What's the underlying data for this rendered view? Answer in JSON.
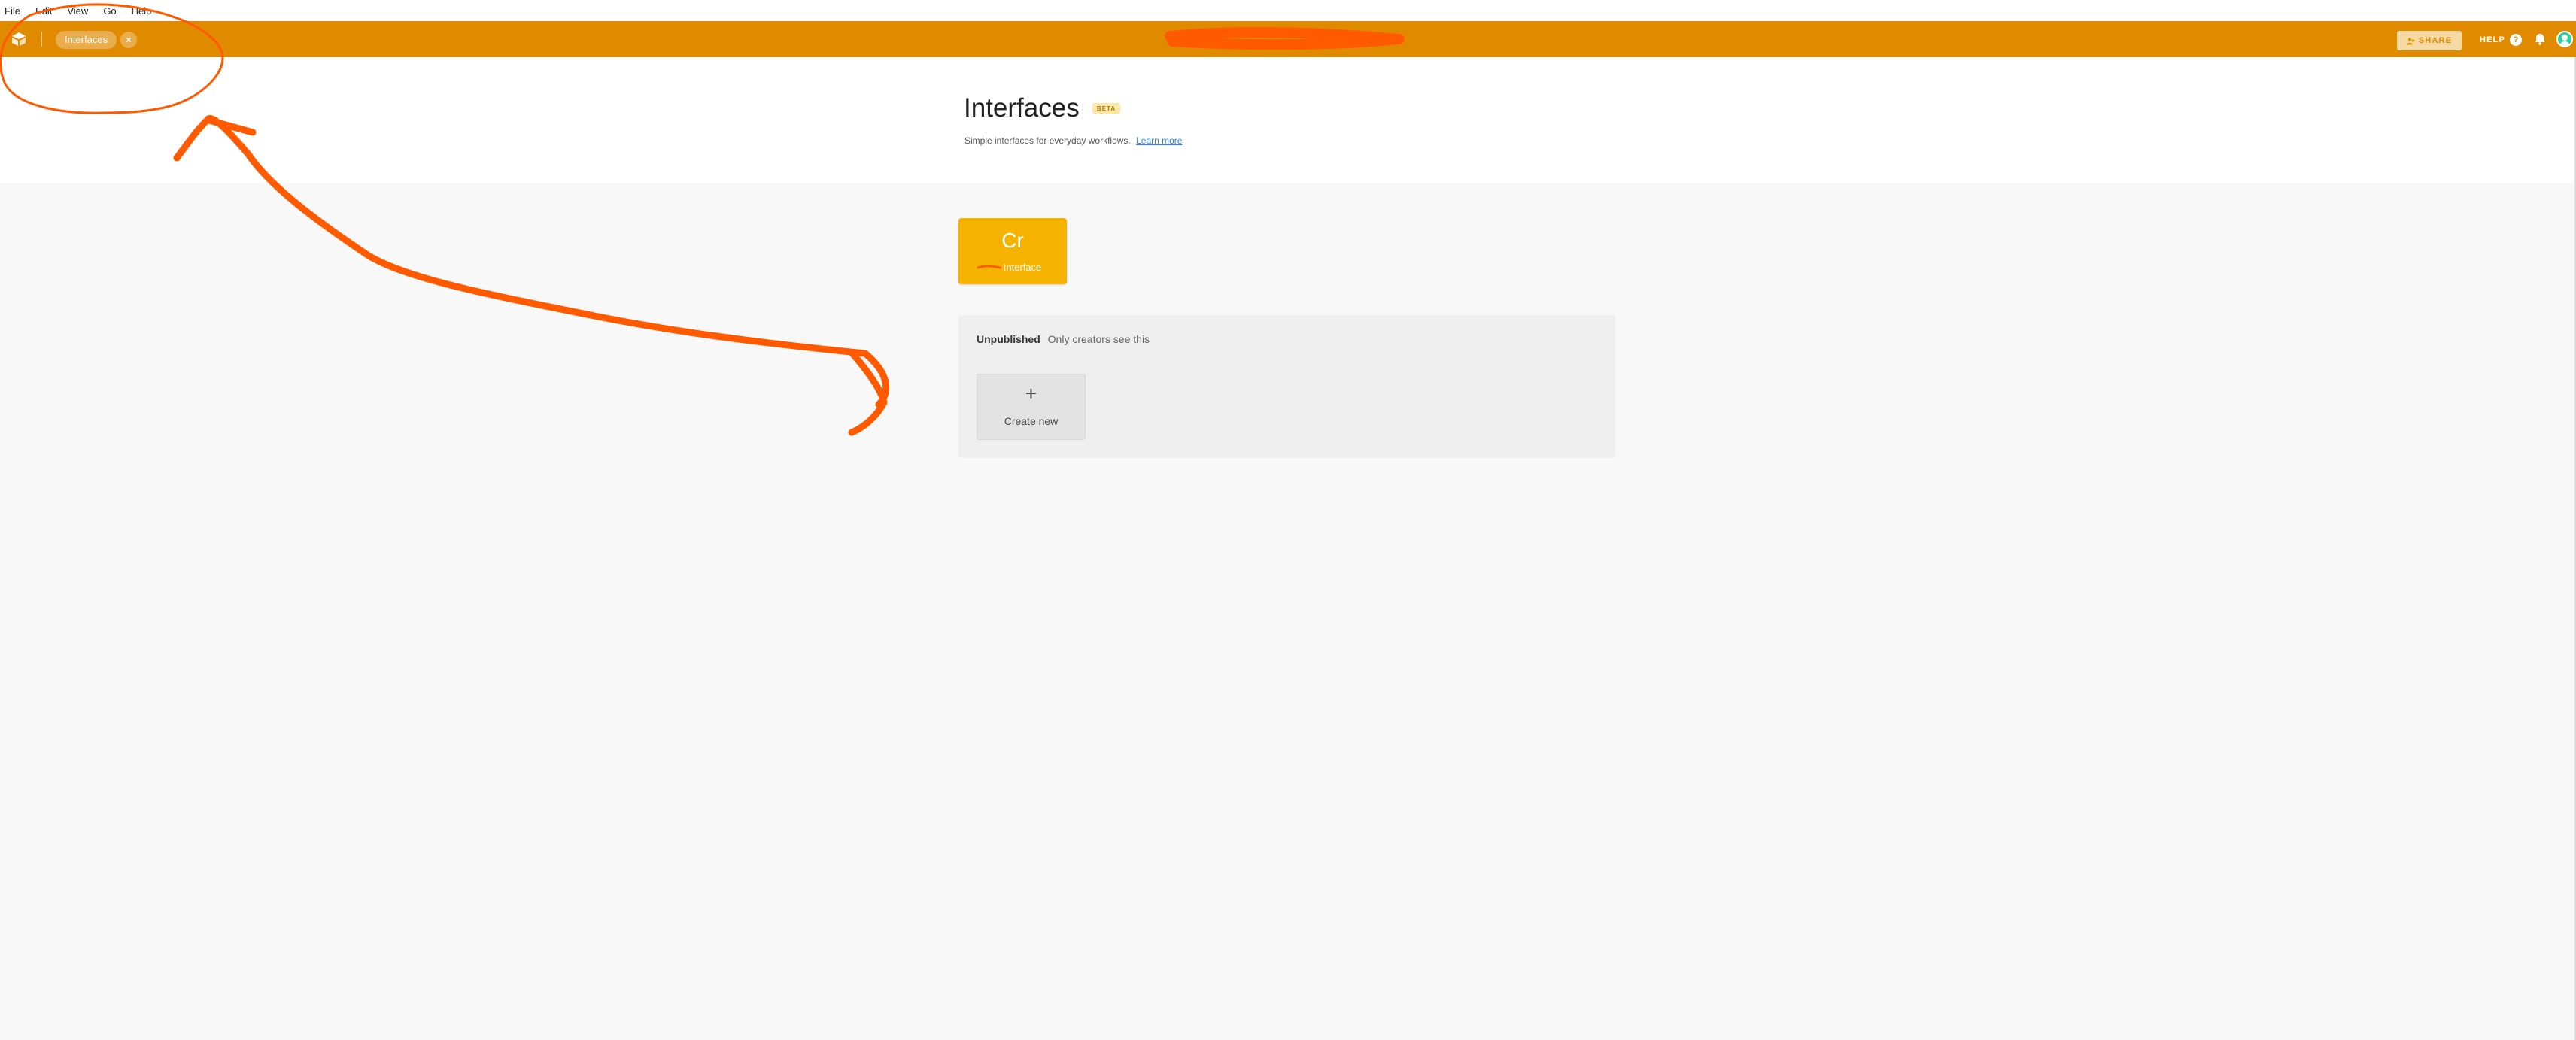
{
  "menubar": {
    "items": [
      "File",
      "Edit",
      "View",
      "Go",
      "Help"
    ]
  },
  "topbar": {
    "breadcrumb": "Interfaces",
    "close_glyph": "×",
    "share_label": "SHARE",
    "help_label": "HELP",
    "help_glyph": "?"
  },
  "page": {
    "title": "Interfaces",
    "badge": "BETA",
    "subtitle": "Simple interfaces for everyday workflows.",
    "learn_more": "Learn more"
  },
  "tile": {
    "initials": "Cr",
    "name": "Interface"
  },
  "unpublished": {
    "heading": "Unpublished",
    "hint": "Only creators see this",
    "create_plus": "+",
    "create_label": "Create new"
  },
  "colors": {
    "topbar": "#e08a00",
    "tile": "#f5b300",
    "annotation": "#ff5a00"
  },
  "icons": [
    "app-logo-icon",
    "close-icon",
    "share-icon",
    "help-icon",
    "bell-icon",
    "avatar-icon",
    "plus-icon"
  ]
}
